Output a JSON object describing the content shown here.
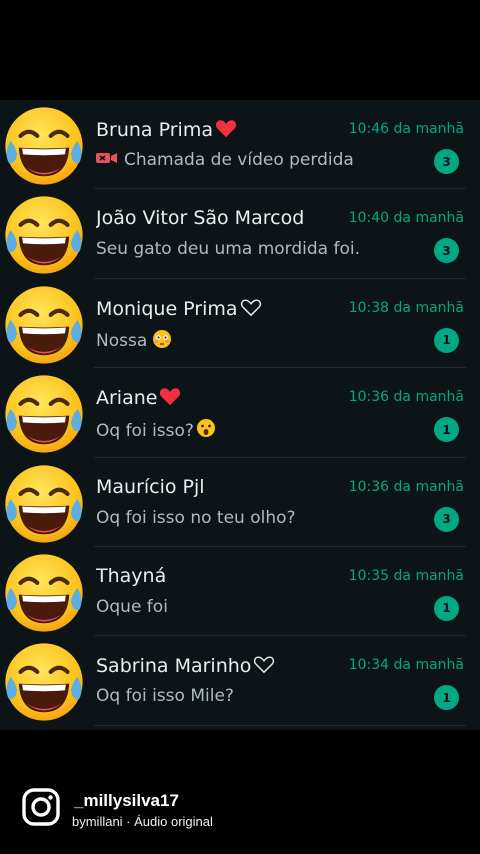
{
  "chats": [
    {
      "name": "Bruna Prima",
      "name_suffix": "heart-red",
      "time": "10:46 da manhã",
      "preview": "Chamada de vídeo perdida",
      "preview_icon": "missed-video-call-icon",
      "unread": "3"
    },
    {
      "name": "João Vitor São Marcod",
      "name_suffix": "",
      "time": "10:40 da manhã",
      "preview": "Seu gato deu uma mordida foi.",
      "preview_icon": "",
      "unread": "3"
    },
    {
      "name": "Monique Prima",
      "name_suffix": "heart-outline",
      "time": "10:38 da manhã",
      "preview": "Nossa",
      "preview_emoji": "flushed-face",
      "unread": "1"
    },
    {
      "name": "Ariane",
      "name_suffix": "heart-red",
      "time": "10:36 da manhã",
      "preview": "Oq foi isso?",
      "preview_emoji": "astonished-face",
      "unread": "1"
    },
    {
      "name": "Maurício Pjl",
      "name_suffix": "",
      "time": "10:36 da manhã",
      "preview": "Oq foi isso no teu olho?",
      "unread": "3"
    },
    {
      "name": "Thayná",
      "name_suffix": "",
      "time": "10:35 da manhã",
      "preview": "Oque foi",
      "unread": "1"
    },
    {
      "name": "Sabrina Marinho",
      "name_suffix": "heart-outline",
      "time": "10:34 da manhã",
      "preview": "Oq foi isso Mile?",
      "unread": "1"
    }
  ],
  "avatar_icon": "tears-of-joy-emoji",
  "instagram": {
    "username": "_millysilva17",
    "audio": "bymillani · Áudio original",
    "icon": "instagram-icon"
  },
  "colors": {
    "background": "#0d1418",
    "accent": "#00a884",
    "name_text": "#e9edef",
    "preview_text": "#aebac1"
  }
}
